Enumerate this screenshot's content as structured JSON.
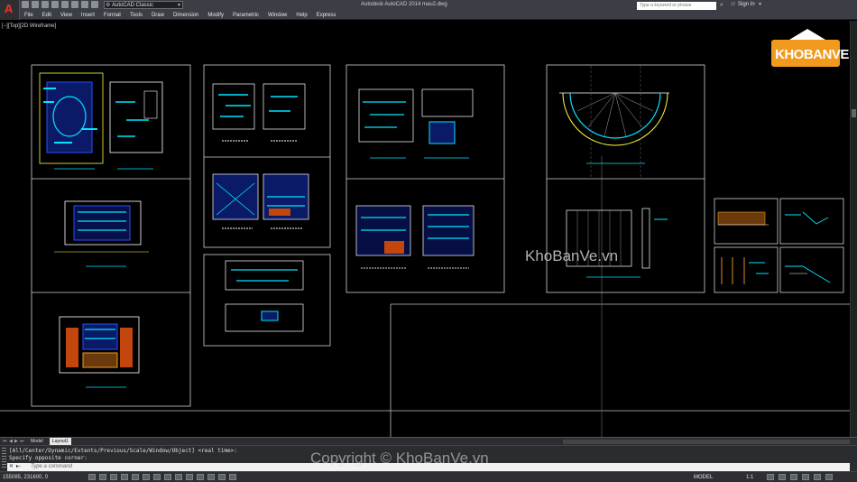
{
  "app": {
    "window_title": "Autodesk AutoCAD 2014    mau2.dwg",
    "workspace": "AutoCAD Classic",
    "search_placeholder": "Type a keyword or phrase",
    "signin": "Sign In"
  },
  "menu": [
    "File",
    "Edit",
    "View",
    "Insert",
    "Format",
    "Tools",
    "Draw",
    "Dimension",
    "Modify",
    "Parametric",
    "Window",
    "Help",
    "Express"
  ],
  "viewport": {
    "label": "[−][Top][2D Wireframe]"
  },
  "tabs": {
    "model": "Model",
    "layout1": "Layout1"
  },
  "command": {
    "history_1": "[All/Center/Dynamic/Extents/Previous/Scale/Window/Object] <real time>:",
    "history_2": "Specify opposite corner:",
    "input_placeholder": "Type a command"
  },
  "status": {
    "coords": "155085, 231600, 0",
    "model": "MODEL",
    "annotation_scale": "1:1"
  },
  "watermarks": {
    "logo": "KHOBANVE",
    "center": "KhoBanVe.vn",
    "bottom": "Copyright © KhoBanVe.vn"
  },
  "colors": {
    "drawing_bg": "#000000",
    "frame": "#d0d0d0",
    "cyan": "#00e5ff",
    "blue": "#2850ff",
    "yellow": "#ffff40",
    "orange": "#f29a1e"
  }
}
